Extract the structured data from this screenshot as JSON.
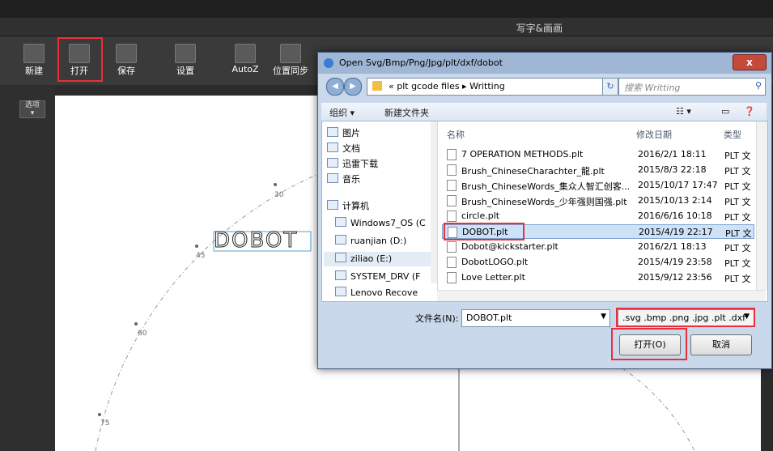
{
  "app": {
    "title": "写字&画画",
    "toolbar": [
      {
        "label": "新建",
        "icon": "new-file-icon"
      },
      {
        "label": "打开",
        "icon": "folder-open-icon"
      },
      {
        "label": "保存",
        "icon": "save-icon"
      },
      {
        "label": "设置",
        "icon": "settings-tools-icon"
      },
      {
        "label": "AutoZ",
        "icon": "autoz-icon"
      },
      {
        "label": "位置同步",
        "icon": "position-sync-icon"
      }
    ],
    "options_label": "选项",
    "canvas_text": "DOBOT",
    "degree_labels": [
      "30",
      "45",
      "60",
      "75"
    ]
  },
  "dialog": {
    "title": "Open Svg/Bmp/Png/Jpg/plt/dxf/dobot",
    "close_label": "x",
    "address": "« plt gcode files ▸ Writting",
    "search_placeholder": "搜索 Writting",
    "commands": {
      "organize": "组织 ▾",
      "new_folder": "新建文件夹"
    },
    "nav_items": [
      "图片",
      "文档",
      "迅雷下载",
      "音乐",
      "计算机",
      "Windows7_OS (C",
      "ruanjian (D:)",
      "ziliao (E:)",
      "SYSTEM_DRV (F",
      "Lenovo Recove"
    ],
    "columns": {
      "name": "名称",
      "date": "修改日期",
      "type": "类型"
    },
    "files": [
      {
        "name": "7 OPERATION METHODS.plt",
        "date": "2016/2/1 18:11",
        "type": "PLT 文"
      },
      {
        "name": "Brush_ChineseCharachter_龍.plt",
        "date": "2015/8/3 22:18",
        "type": "PLT 文"
      },
      {
        "name": "Brush_ChineseWords_集众人智汇创客...",
        "date": "2015/10/17 17:47",
        "type": "PLT 文"
      },
      {
        "name": "Brush_ChineseWords_少年强则国强.plt",
        "date": "2015/10/13 2:14",
        "type": "PLT 文"
      },
      {
        "name": "circle.plt",
        "date": "2016/6/16 10:18",
        "type": "PLT 文"
      },
      {
        "name": "DOBOT.plt",
        "date": "2015/4/19 22:17",
        "type": "PLT 文"
      },
      {
        "name": "Dobot@kickstarter.plt",
        "date": "2016/2/1 18:13",
        "type": "PLT 文"
      },
      {
        "name": "DobotLOGO.plt",
        "date": "2015/4/19 23:58",
        "type": "PLT 文"
      },
      {
        "name": "Love Letter.plt",
        "date": "2015/9/12 23:56",
        "type": "PLT 文"
      }
    ],
    "filename_label": "文件名(N):",
    "filename_value": "DOBOT.plt",
    "filter_value": ".svg .bmp .png .jpg .plt .dxf",
    "open_button": "打开(O)",
    "cancel_button": "取消"
  }
}
